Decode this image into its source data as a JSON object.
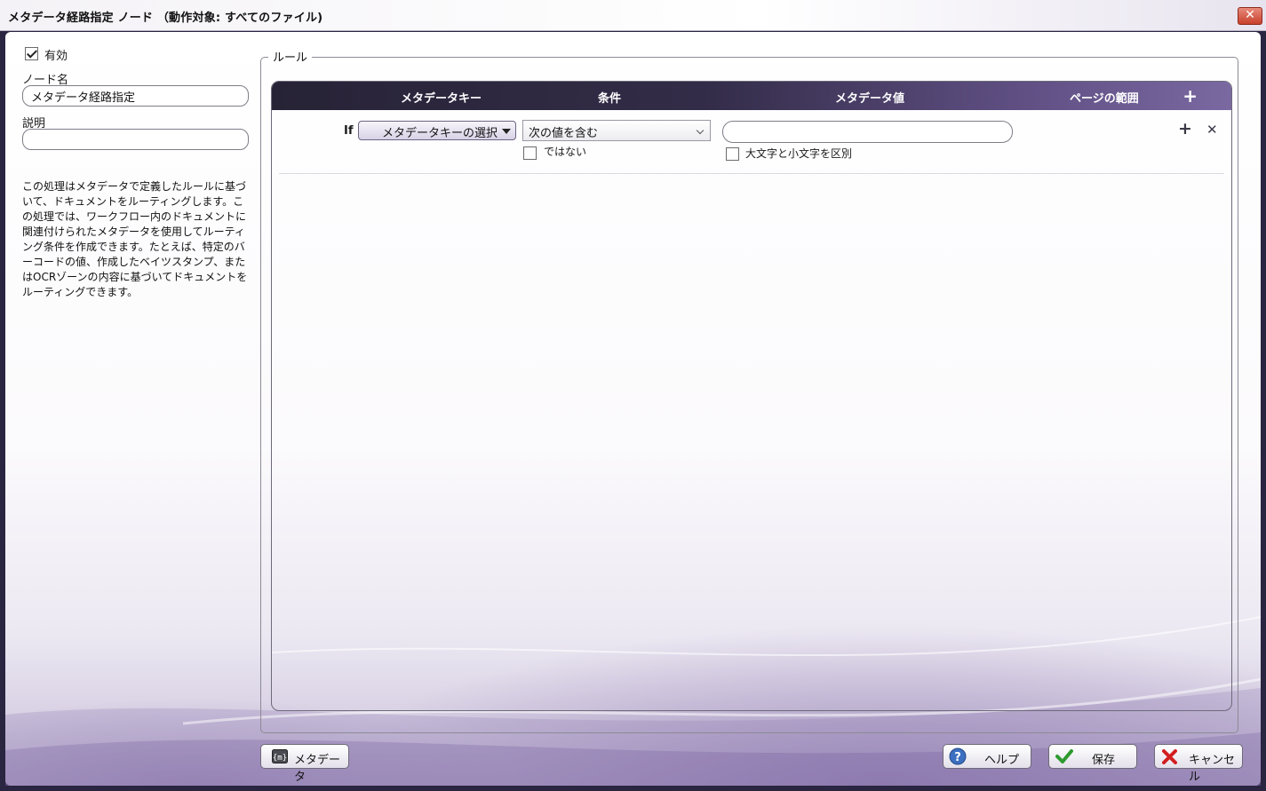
{
  "window": {
    "title": "メタデータ経路指定 ノード （動作対象: すべてのファイル)",
    "close_glyph": "✕"
  },
  "left": {
    "enabled_label": "有効",
    "enabled_checked": true,
    "node_name_label": "ノード名",
    "node_name_value": "メタデータ経路指定",
    "description_label": "説明",
    "description_value": "",
    "help_text": "この処理はメタデータで定義したルールに基づいて、ドキュメントをルーティングします。この処理では、ワークフロー内のドキュメントに関連付けられたメタデータを使用してルーティング条件を作成できます。たとえば、特定のバーコードの値、作成したベイツスタンプ、またはOCRゾーンの内容に基づいてドキュメントをルーティングできます。"
  },
  "rules": {
    "group_label": "ルール",
    "columns": [
      "メタデータキー",
      "条件",
      "メタデータ値",
      "ページの範囲"
    ],
    "add_glyph": "+",
    "row": {
      "if_label": "If",
      "key_select_label": "メタデータキーの選択",
      "condition_value": "次の値を含む",
      "not_label": "ではない",
      "not_checked": false,
      "value": "",
      "case_sensitive_label": "大文字と小文字を区別",
      "case_sensitive_checked": false,
      "add_glyph": "+",
      "remove_glyph": "✕"
    }
  },
  "footer": {
    "metadata_button": "メタデータ",
    "help_button": "ヘルプ",
    "save_button": "保存",
    "cancel_button": "キャンセル"
  },
  "colors": {
    "header_dark": "#272336",
    "header_light": "#7a68a1",
    "close_red": "#c8402b",
    "save_check": "#2e9a2e",
    "cancel_x": "#d21f1f",
    "help_icon": "#3c6fc0"
  },
  "icons": {
    "close": "close-icon",
    "metadata": "metadata-icon",
    "help": "question-icon",
    "save": "checkmark-icon",
    "cancel": "x-icon"
  }
}
